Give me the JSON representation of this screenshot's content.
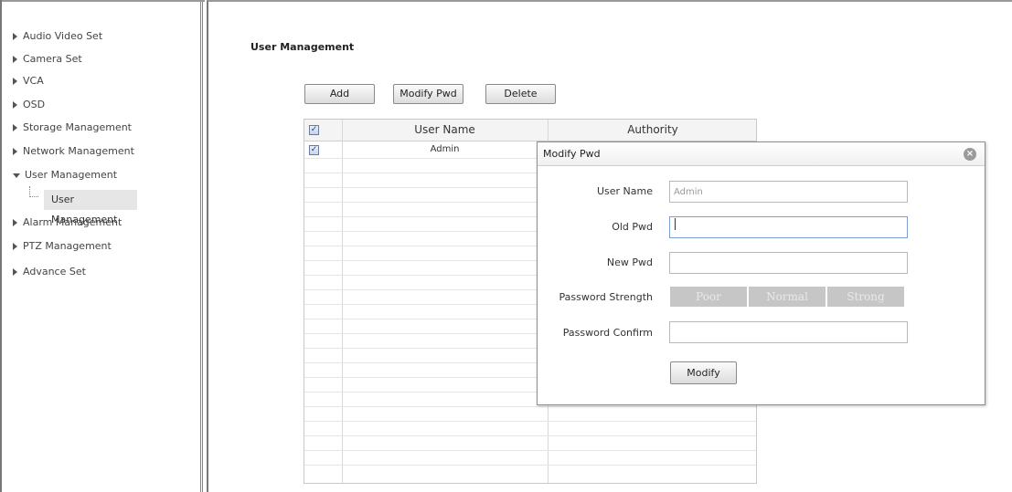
{
  "sidebar": {
    "items": [
      {
        "label": "Audio Video Set",
        "expanded": false
      },
      {
        "label": "Camera Set",
        "expanded": false
      },
      {
        "label": "VCA",
        "expanded": false
      },
      {
        "label": "OSD",
        "expanded": false
      },
      {
        "label": "Storage Management",
        "expanded": false
      },
      {
        "label": "Network Management",
        "expanded": false
      },
      {
        "label": "User Management",
        "expanded": true
      },
      {
        "label": "Alarm Management",
        "expanded": false
      },
      {
        "label": "PTZ Management",
        "expanded": false
      },
      {
        "label": "Advance Set",
        "expanded": false
      }
    ],
    "sub_item": {
      "label": "User Management",
      "selected": true
    }
  },
  "main": {
    "title": "User Management",
    "buttons": {
      "add": "Add",
      "modify_pwd": "Modify Pwd",
      "delete": "Delete"
    },
    "table": {
      "columns": [
        "User Name",
        "Authority"
      ],
      "header_checked": true,
      "rows": [
        {
          "checked": true,
          "user_name": "Admin",
          "authority": ""
        }
      ]
    }
  },
  "dialog": {
    "title": "Modify Pwd",
    "fields": {
      "user_name": {
        "label": "User Name",
        "value": "Admin"
      },
      "old_pwd": {
        "label": "Old Pwd",
        "value": ""
      },
      "new_pwd": {
        "label": "New Pwd",
        "value": ""
      },
      "strength": {
        "label": "Password Strength",
        "levels": [
          "Poor",
          "Normal",
          "Strong"
        ]
      },
      "confirm": {
        "label": "Password Confirm",
        "value": ""
      }
    },
    "submit_label": "Modify"
  },
  "colors": {
    "strength_inactive": "#c6c6c6",
    "selected_bg": "#e6e6e6"
  }
}
